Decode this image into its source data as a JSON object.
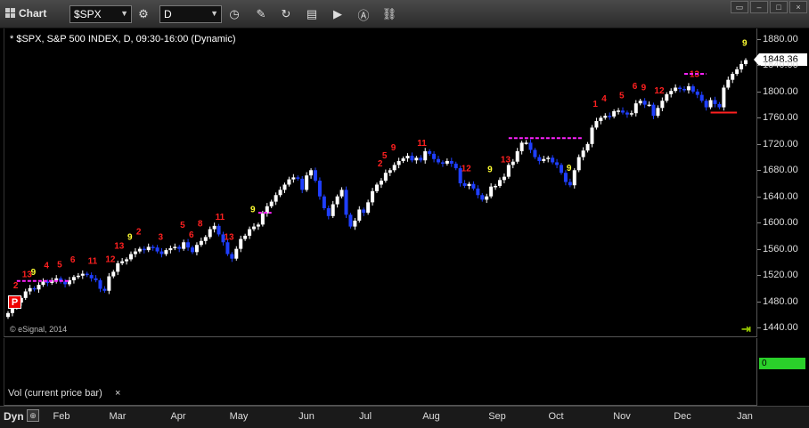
{
  "toolbar": {
    "title": "Chart",
    "symbol_value": "$SPX",
    "interval_value": "D"
  },
  "chart": {
    "symbol_label": "* $SPX, S&P 500 INDEX, D, 09:30-16:00 (Dynamic)",
    "watermark": "© eSignal, 2014",
    "badge": "P",
    "last_price": "1848.36",
    "colors": {
      "up": "#ffffff",
      "down": "#1f3fff",
      "buy_setup": "#ffff33",
      "sell_setup": "#ff2020",
      "tdst": "#ff22ff"
    }
  },
  "volume": {
    "label": "Vol (current price bar)",
    "close": "×",
    "value": "0"
  },
  "date_axis": {
    "dyn_label": "Dyn",
    "months": [
      "Feb",
      "Mar",
      "Apr",
      "May",
      "Jun",
      "Jul",
      "Aug",
      "Sep",
      "Oct",
      "Nov",
      "Dec",
      "Jan"
    ]
  },
  "chart_data": {
    "type": "candlestick",
    "y_ticks": [
      1440,
      1480,
      1520,
      1560,
      1600,
      1640,
      1680,
      1720,
      1760,
      1800,
      1840,
      1880
    ],
    "ylim": [
      1430,
      1890
    ],
    "x_range_months": [
      "Jan 2013",
      "Jan 2014"
    ],
    "closes": [
      1462,
      1470,
      1478,
      1485,
      1495,
      1500,
      1498,
      1505,
      1510,
      1508,
      1512,
      1515,
      1510,
      1506,
      1512,
      1517,
      1519,
      1522,
      1520,
      1515,
      1512,
      1499,
      1496,
      1518,
      1525,
      1538,
      1541,
      1544,
      1552,
      1556,
      1560,
      1558,
      1563,
      1562,
      1556,
      1552,
      1558,
      1561,
      1563,
      1560,
      1570,
      1562,
      1555,
      1566,
      1572,
      1578,
      1590,
      1595,
      1582,
      1570,
      1552,
      1545,
      1560,
      1575,
      1580,
      1590,
      1594,
      1597,
      1614,
      1625,
      1632,
      1642,
      1650,
      1658,
      1666,
      1669,
      1667,
      1650,
      1672,
      1680,
      1664,
      1640,
      1622,
      1610,
      1628,
      1640,
      1650,
      1612,
      1594,
      1603,
      1620,
      1615,
      1631,
      1648,
      1658,
      1664,
      1676,
      1680,
      1688,
      1694,
      1698,
      1702,
      1695,
      1699,
      1695,
      1709,
      1705,
      1697,
      1692,
      1690,
      1694,
      1690,
      1683,
      1660,
      1656,
      1659,
      1652,
      1642,
      1635,
      1640,
      1655,
      1656,
      1665,
      1670,
      1688,
      1693,
      1709,
      1722,
      1722,
      1711,
      1700,
      1694,
      1697,
      1699,
      1692,
      1688,
      1676,
      1662,
      1657,
      1680,
      1700,
      1710,
      1720,
      1745,
      1755,
      1760,
      1763,
      1762,
      1770,
      1771,
      1768,
      1765,
      1767,
      1782,
      1786,
      1780,
      1780,
      1763,
      1775,
      1786,
      1796,
      1801,
      1806,
      1804,
      1802,
      1808,
      1800,
      1795,
      1786,
      1776,
      1787,
      1781,
      1776,
      1806,
      1818,
      1827,
      1834,
      1842,
      1848
    ]
  }
}
